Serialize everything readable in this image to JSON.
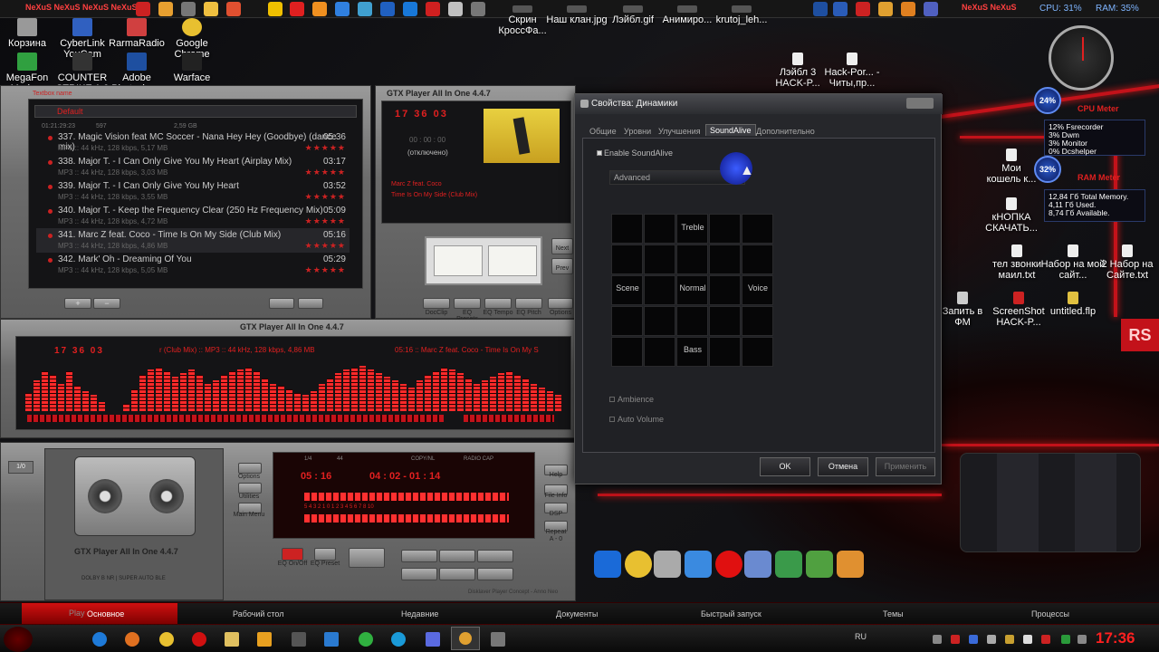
{
  "top_strip": {
    "logo_text": "NeXuS NeXuS NeXuS NeXuS",
    "logo_text_right": "NeXuS NeXuS",
    "cpu": "CPU: 31%",
    "ram": "RAM: 35%"
  },
  "desktop_icons": [
    {
      "label": "Корзина"
    },
    {
      "label": "CyberLink YouCam"
    },
    {
      "label": "RarmaRadio"
    },
    {
      "label": "Google Chrome"
    },
    {
      "label": "MegaFon Modem"
    },
    {
      "label": "COUNTER STRIKE 1.6"
    },
    {
      "label": "Adobe Photosho..."
    },
    {
      "label": "Warface"
    },
    {
      "label": "Скрин КроссФа..."
    },
    {
      "label": "Наш клан.jpg"
    },
    {
      "label": "Лэйбл.gif"
    },
    {
      "label": "Анимиро..."
    },
    {
      "label": "krutoj_leh..."
    },
    {
      "label": "Лэйбл 3 HACK-P..."
    },
    {
      "label": "Hack-Por... - Читы,пр..."
    },
    {
      "label": "Мои кошель к..."
    },
    {
      "label": "кНОПКА СКАЧАТЬ..."
    },
    {
      "label": "тел звонки маил.txt"
    },
    {
      "label": "Набор на мой сайт..."
    },
    {
      "label": "2 Набор на Сайте.txt"
    },
    {
      "label": "Запить в ФМ"
    },
    {
      "label": "ScreenShot HACK-P..."
    },
    {
      "label": "untitled.flp"
    }
  ],
  "player": {
    "playlist_title": "Default",
    "playlist_header_label": "Textbox name",
    "stats_left": "01:21:29:23",
    "stats_count": "597",
    "stats_size": "2,59 GB",
    "tracks": [
      {
        "title": "337. Magic Vision feat MC Soccer - Nana Hey Hey (Goodbye) (dance mix)",
        "dur": "05:36",
        "sub": "MP3 :: 44 kHz, 128 kbps, 5,17 MB"
      },
      {
        "title": "338. Major T. - I Can Only Give You My Heart (Airplay Mix)",
        "dur": "03:17",
        "sub": "MP3 :: 44 kHz, 128 kbps, 3,03 MB"
      },
      {
        "title": "339. Major T. - I Can Only Give You My Heart",
        "dur": "03:52",
        "sub": "MP3 :: 44 kHz, 128 kbps, 3,55 MB"
      },
      {
        "title": "340. Major T. - Keep the Frequency Clear (250 Hz Frequency Mix)",
        "dur": "05:09",
        "sub": "MP3 :: 44 kHz, 128 kbps, 4,72 MB"
      },
      {
        "title": "341. Marc Z feat. Coco - Time Is On My Side (Club Mix)",
        "dur": "05:16",
        "sub": "MP3 :: 44 kHz, 128 kbps, 4,86 MB"
      },
      {
        "title": "342. Mark' Oh - Dreaming Of You",
        "dur": "05:29",
        "sub": "MP3 :: 44 kHz, 128 kbps, 5,05 MB"
      }
    ],
    "stars": "★★★★★",
    "btn_add": "+",
    "btn_remove": "−",
    "small_title": "GTX Player All In One 4.4.7",
    "time_top": "17 36 03",
    "time_zero": "00 : 00 : 00",
    "disconnected": "(отключено)",
    "now_artist": "Marc Z feat. Coco",
    "now_track": "Time Is On My Side (Club Mix)",
    "btn_next": "Next",
    "btn_prev": "Prev",
    "eq_labels": [
      "DocClip",
      "EQ Presets",
      "EQ Tempo",
      "EQ Pitch",
      "Options"
    ],
    "main_title": "GTX Player All In One 4.4.7",
    "scroll_time": "17 36 03",
    "scroll_text": "r (Club Mix) :: MP3 :: 44 kHz, 128 kbps, 4,86 MB",
    "scroll_text2": "05:16 :: Marc Z feat. Coco - Time Is On My S",
    "deck_title": "GTX Player All In One 4.4.7",
    "deck_sub": "DOLBY B NR | SUPER AUTO BLE",
    "side_left": "Options",
    "side_left2": "Utilities",
    "side_left3": "Main Menu",
    "lcd_top_a": "1/4",
    "lcd_top_b": "44",
    "lcd_top_c": "COPY/NL",
    "lcd_top_d": "RADIO CAP",
    "lcd_time": "05 : 16",
    "lcd_time2": "04 : 02 - 01 : 14",
    "lcd_scale": "5  4  3  2  1  0  1  2  3  4  5  6  7  8  10",
    "side_right": [
      "Help",
      "File Info",
      "DSP",
      "Repeat"
    ],
    "side_right_repeat": "A - 0",
    "eq_on": "EQ On/Off",
    "eq_preset": "EQ Preset",
    "footer": "Disklaver Player Concept - Anno Neo",
    "tag": "1/0"
  },
  "dialog": {
    "title": "Свойства: Динамики",
    "tabs": [
      "Общие",
      "Уровни",
      "Улучшения",
      "SoundAlive",
      "Дополнительно"
    ],
    "active_tab": "SoundAlive",
    "enable_label": "Enable SoundAlive",
    "preset_value": "Advanced",
    "grid_labels": {
      "treble": "Treble",
      "scene": "Scene",
      "normal": "Normal",
      "voice": "Voice",
      "bass": "Bass"
    },
    "ambience": "Ambience",
    "auto_volume": "Auto Volume",
    "ok": "OK",
    "cancel": "Отмена",
    "apply": "Применить"
  },
  "meters": {
    "cpu_title": "CPU Meter",
    "cpu_pct": "24%",
    "cpu_lines": [
      "12% Fsrecorder",
      "3% Dwm",
      "3% Monitor",
      "0% Dcshelper"
    ],
    "ram_title": "RAM Meter",
    "ram_pct": "32%",
    "ram_lines": [
      "12,84 Гб Total Memory.",
      "4,11 Гб Used.",
      "8,74 Гб Available."
    ],
    "rs": "RS"
  },
  "menu_bar": {
    "start_label": "Основное",
    "play_label": "Play",
    "items": [
      "Рабочий стол",
      "Недавние",
      "Документы",
      "Быстрый запуск",
      "Темы",
      "Процессы"
    ]
  },
  "taskbar": {
    "lang": "RU",
    "clock": "17:36"
  },
  "colors": {
    "accent": "#c3121a",
    "lcd": "#e12020",
    "meter": "#2a58c8"
  }
}
